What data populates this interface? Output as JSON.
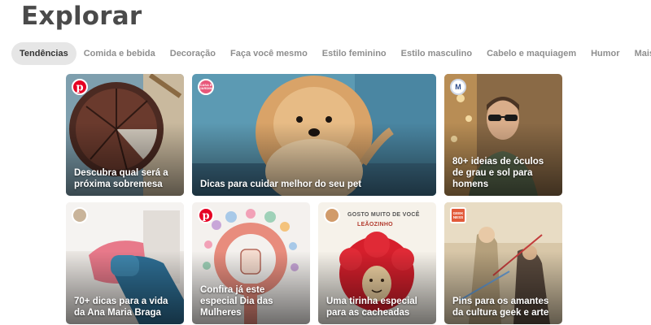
{
  "page": {
    "title": "Explorar"
  },
  "tabs": [
    {
      "label": "Tendências",
      "active": true
    },
    {
      "label": "Comida e bebida"
    },
    {
      "label": "Decoração"
    },
    {
      "label": "Faça você mesmo"
    },
    {
      "label": "Estilo feminino"
    },
    {
      "label": "Estilo masculino"
    },
    {
      "label": "Cabelo e maquiagem"
    },
    {
      "label": "Humor"
    },
    {
      "label": "Mais"
    }
  ],
  "cards": [
    {
      "caption": "Descubra qual será a próxima sobremesa",
      "badge": "pinterest-logo-icon"
    },
    {
      "caption": "Dicas para cuidar melhor do seu pet",
      "badge": "casa-e-jardim-logo",
      "badge_text": "CASA E JARDIM"
    },
    {
      "caption": "80+ ideias de óculos de grau e sol para homens",
      "badge": "m-logo",
      "badge_text": "M"
    },
    {
      "caption": "70+ dicas para a vida da Ana Maria Braga",
      "badge": "avatar"
    },
    {
      "caption": "Confira já este especial Dia das Mulheres",
      "badge": "pinterest-logo-icon"
    },
    {
      "caption": "Uma tirinha especial para as cacheadas",
      "badge": "avatar",
      "illustration_text": [
        "GOSTO MUITO DE VOCÊ",
        "LEÃOZINHO"
      ]
    },
    {
      "caption": "Pins para os amantes da cultura geek e arte",
      "badge": "geek-ness-logo",
      "badge_text": "GEEK NESS"
    }
  ],
  "colors": {
    "pinterest_red": "#e60023",
    "tab_active_bg": "#e6e6e6",
    "title": "#4a4a4a"
  }
}
